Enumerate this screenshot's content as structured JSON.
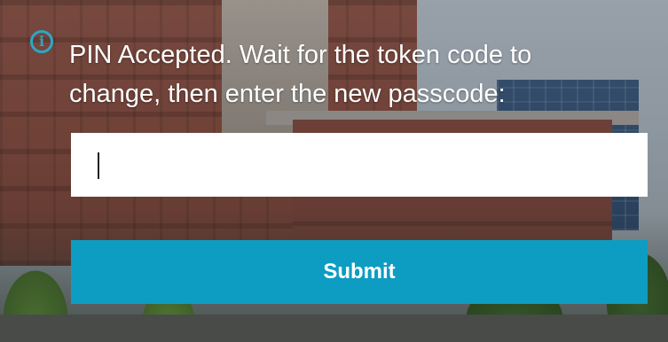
{
  "info": {
    "icon": "info-icon",
    "glyph": "i"
  },
  "message": {
    "line1": "PIN Accepted. Wait for the token code to",
    "line2": "change, then enter the new passcode:"
  },
  "passcode_input": {
    "value": "",
    "placeholder": ""
  },
  "submit": {
    "label": "Submit"
  },
  "colors": {
    "accent": "#0e9dc2",
    "icon": "#2aa9c4",
    "text": "#ffffff"
  }
}
